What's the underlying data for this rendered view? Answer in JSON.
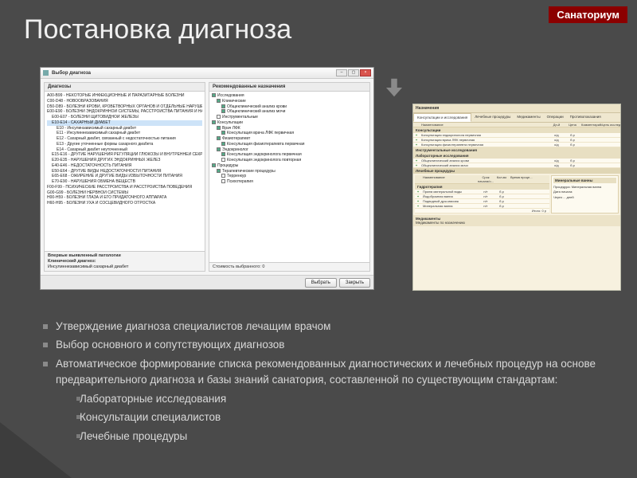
{
  "brand": "Санаториум",
  "title": "Постановка диагноза",
  "dialog": {
    "window_title": "Выбор диагноза",
    "left_header": "Диагнозы",
    "right_header": "Рекомендованные назначения",
    "tree": [
      {
        "lvl": 0,
        "txt": "A00-B99 - НЕКОТОРЫЕ ИНФЕКЦИОННЫЕ И ПАРАЗИТАРНЫЕ БОЛЕЗНИ"
      },
      {
        "lvl": 0,
        "txt": "C00-D48 - НОВООБРАЗОВАНИЯ"
      },
      {
        "lvl": 0,
        "txt": "D50-D89 - БОЛЕЗНИ КРОВИ, КРОВЕТВОРНЫХ ОРГАНОВ И ОТДЕЛЬНЫЕ НАРУШЕНИЯ, ВОВЛЕК"
      },
      {
        "lvl": 0,
        "txt": "E00-E90 - БОЛЕЗНИ ЭНДОКРИННОЙ СИСТЕМЫ, РАССТРОЙСТВА ПИТАНИЯ И НАРУШЕНИЯ ОБМ"
      },
      {
        "lvl": 1,
        "txt": "E00-E07 - БОЛЕЗНИ ЩИТОВИДНОЙ ЖЕЛЕЗЫ"
      },
      {
        "lvl": 1,
        "txt": "E10-E14 - САХАРНЫЙ ДИАБЕТ",
        "sel": true
      },
      {
        "lvl": 2,
        "txt": "E10 - Инсулинзависимый сахарный диабет"
      },
      {
        "lvl": 2,
        "txt": "E11 - Инсулиннезависимый сахарный диабет"
      },
      {
        "lvl": 2,
        "txt": "E12 - Сахарный диабет, связанный с недостаточностью питания"
      },
      {
        "lvl": 2,
        "txt": "E13 - Другие уточненные формы сахарного диабета"
      },
      {
        "lvl": 2,
        "txt": "E14 - Сахарный диабет неуточненный"
      },
      {
        "lvl": 1,
        "txt": "E15-E16 - ДРУГИЕ НАРУШЕНИЯ РЕГУЛЯЦИИ ГЛЮКОЗЫ И ВНУТРЕННЕЙ СЕКРЕЦИИ ПОДЖЕЛ"
      },
      {
        "lvl": 1,
        "txt": "E20-E35 - НАРУШЕНИЯ ДРУГИХ ЭНДОКРИННЫХ ЖЕЛЕЗ"
      },
      {
        "lvl": 1,
        "txt": "E40-E46 - НЕДОСТАТОЧНОСТЬ ПИТАНИЯ"
      },
      {
        "lvl": 1,
        "txt": "E50-E64 - ДРУГИЕ ВИДЫ НЕДОСТАТОЧНОСТИ ПИТАНИЯ"
      },
      {
        "lvl": 1,
        "txt": "E65-E68 - ОЖИРЕНИЕ И ДРУГИЕ ВИДЫ ИЗБЫТОЧНОСТИ ПИТАНИЯ"
      },
      {
        "lvl": 1,
        "txt": "E70-E90 - НАРУШЕНИЯ ОБМЕНА ВЕЩЕСТВ"
      },
      {
        "lvl": 0,
        "txt": "F00-F99 - ПСИХИЧЕСКИЕ РАССТРОЙСТВА И РАССТРОЙСТВА ПОВЕДЕНИЯ"
      },
      {
        "lvl": 0,
        "txt": "G00-G99 - БОЛЕЗНИ НЕРВНОЙ СИСТЕМЫ"
      },
      {
        "lvl": 0,
        "txt": "H00-H59 - БОЛЕЗНИ ГЛАЗА И ЕГО ПРИДАТОЧНОГО АППАРАТА"
      },
      {
        "lvl": 0,
        "txt": "H60-H95 - БОЛЕЗНИ УХА И СОСЦЕВИДНОГО ОТРОСТКА"
      }
    ],
    "rec": [
      {
        "lvl": 0,
        "chk": true,
        "txt": "Исследования"
      },
      {
        "lvl": 1,
        "chk": true,
        "txt": "Клинические"
      },
      {
        "lvl": 2,
        "chk": true,
        "txt": "Общеклинический анализ крови"
      },
      {
        "lvl": 2,
        "chk": true,
        "txt": "Общеклинический анализ мочи"
      },
      {
        "lvl": 1,
        "chk": false,
        "txt": "Инструментальные"
      },
      {
        "lvl": 0,
        "chk": true,
        "txt": "Консультации"
      },
      {
        "lvl": 1,
        "chk": true,
        "txt": "Врач ЛФК"
      },
      {
        "lvl": 2,
        "chk": true,
        "txt": "Консультация врача ЛФК первичная"
      },
      {
        "lvl": 1,
        "chk": true,
        "txt": "Физиотерапевт"
      },
      {
        "lvl": 2,
        "chk": true,
        "txt": "Консультация физиотерапевта первичная"
      },
      {
        "lvl": 1,
        "chk": true,
        "txt": "Эндокринолог"
      },
      {
        "lvl": 2,
        "chk": true,
        "txt": "Консультация эндокринолога первичная"
      },
      {
        "lvl": 2,
        "chk": false,
        "txt": "Консультация эндокринолога повторная"
      },
      {
        "lvl": 0,
        "chk": true,
        "txt": "Процедуры"
      },
      {
        "lvl": 1,
        "chk": true,
        "txt": "Терапевтические процедуры"
      },
      {
        "lvl": 2,
        "chk": false,
        "txt": "Терренкур"
      },
      {
        "lvl": 2,
        "chk": false,
        "txt": "Психотерапия"
      }
    ],
    "prev_label": "Впервые выявленный патологии",
    "clin_label": "Клинический диагноз:",
    "clin_value": "Инсулиннезависимый сахарный диабет",
    "cost_label": "Стоимость выбранного: 0",
    "btn_select": "Выбрать",
    "btn_close": "Закрыть"
  },
  "rpanel": {
    "header": "Назначения",
    "tabs": [
      "Консультации и исследования",
      "Лечебные процедуры",
      "Медикаменты",
      "Операции",
      "Противопоказания"
    ],
    "cols": {
      "name": "Наименование",
      "c3": "Дн-й",
      "c4": "Цена",
      "c5": "Комментарий/цель исследован..."
    },
    "sec_consult": "Консультации",
    "consult_rows": [
      {
        "name": "Консультация эндокринолога первичная",
        "d": "к/д",
        "p": "б.р"
      },
      {
        "name": "Консультация врача ЛФК первичная",
        "d": "к/д",
        "p": "б.р"
      },
      {
        "name": "Консультация физиотерапевта первичная",
        "d": "к/д",
        "p": "б.р"
      }
    ],
    "sec_instr": "Инструментальные исследования",
    "sec_lab": "Лабораторные исследования",
    "lab_rows": [
      {
        "name": "Общеклинический анализ крови",
        "d": "к/д",
        "p": "б.р"
      },
      {
        "name": "Общеклинический анализ мочи",
        "d": "к/д",
        "p": "б.р"
      }
    ],
    "sec_treat": "Лечебные процедуры",
    "treat_cols": {
      "name": "Наименование",
      "c3": "Срок начала/о...",
      "c4": "Кол-во",
      "c5": "Время проце..."
    },
    "sec_hydro": "Гидротерапия",
    "hydro_rows": [
      {
        "name": "Прием минеральной воды",
        "d": "н/т",
        "p": "б.р"
      },
      {
        "name": "Йодобромная ванна",
        "d": "н/т",
        "p": "б.р"
      },
      {
        "name": "Подводный душ-массаж",
        "d": "н/т",
        "p": "б.р"
      },
      {
        "name": "Минеральная ванна",
        "d": "н/т",
        "p": "б.р"
      }
    ],
    "total": "Итого: 0 р",
    "detail_header": "Минеральные ванны",
    "detail_label1": "Процедура:",
    "detail_val1": "Минеральная ванна",
    "detail_label2": "Дата начала:",
    "detail_label3": "Через ... дней",
    "sec_med": "Медикаменты",
    "med_sub": "Медикаменты по назначению"
  },
  "bullets": [
    "Утверждение диагноза специалистов лечащим врачом",
    "Выбор основного и сопутствующих диагнозов",
    "Автоматическое формирование списка рекомендованных диагностических и лечебных процедур на основе предварительного диагноза и базы знаний санатория, составленной по существующим стандартам:"
  ],
  "sub_bullets": [
    "Лабораторные исследования",
    "Консультации специалистов",
    "Лечебные процедуры"
  ]
}
